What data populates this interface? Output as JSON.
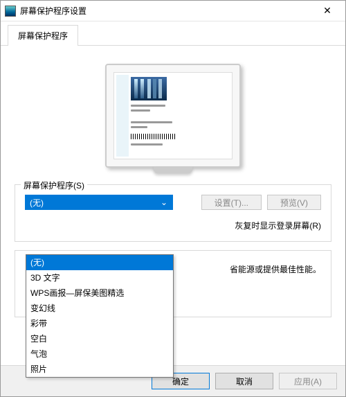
{
  "window": {
    "title": "屏幕保护程序设置",
    "close_icon": "✕"
  },
  "tab": {
    "label": "屏幕保护程序"
  },
  "group_saver": {
    "legend": "屏幕保护程序(S)",
    "selected": "(无)",
    "chevron": "⌄",
    "settings_btn": "设置(T)...",
    "preview_btn": "预览(V)",
    "resume_text_right": "灰复时显示登录屏幕(R)"
  },
  "dropdown_options": [
    "(无)",
    "3D 文字",
    "WPS画报—屏保美图精选",
    "变幻线",
    "彩带",
    "空白",
    "气泡",
    "照片"
  ],
  "group_power": {
    "partial_text": "省能源或提供最佳性能。"
  },
  "footer": {
    "ok": "确定",
    "cancel": "取消",
    "apply": "应用(A)"
  }
}
